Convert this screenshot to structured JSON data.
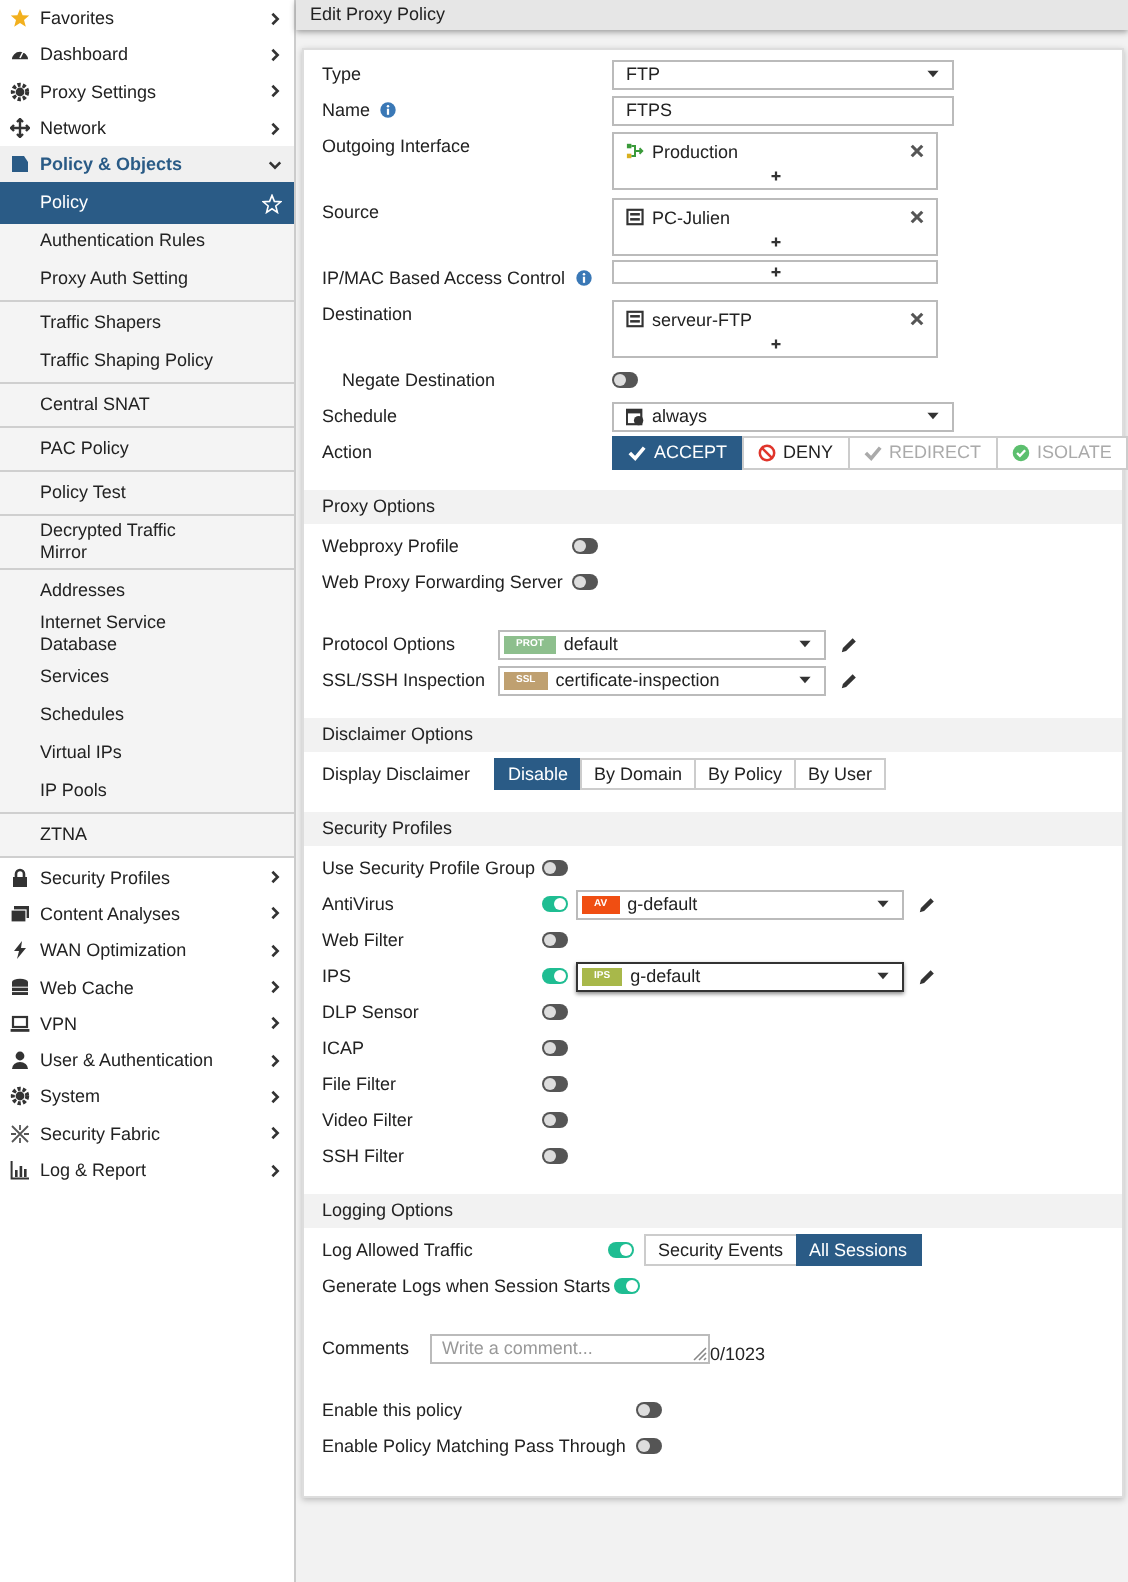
{
  "sidebar": {
    "items": [
      {
        "label": "Favorites",
        "expanded": false
      },
      {
        "label": "Dashboard",
        "expanded": false
      },
      {
        "label": "Proxy Settings",
        "expanded": false
      },
      {
        "label": "Network",
        "expanded": false
      },
      {
        "label": "Policy & Objects",
        "expanded": true,
        "child_groups": [
          {
            "items": [
              {
                "label": "Policy",
                "selected": true
              },
              {
                "label": "Authentication Rules",
                "selected": false
              },
              {
                "label": "Proxy Auth Setting",
                "selected": false
              }
            ]
          },
          {
            "items": [
              {
                "label": "Traffic Shapers",
                "selected": false
              },
              {
                "label": "Traffic Shaping Policy",
                "selected": false
              }
            ]
          },
          {
            "items": [
              {
                "label": "Central SNAT",
                "selected": false
              }
            ]
          },
          {
            "items": [
              {
                "label": "PAC Policy",
                "selected": false
              }
            ]
          },
          {
            "items": [
              {
                "label": "Policy Test",
                "selected": false
              }
            ]
          },
          {
            "items": [
              {
                "label": "Decrypted Traffic Mirror",
                "selected": false
              }
            ]
          },
          {
            "items": [
              {
                "label": "Addresses",
                "selected": false
              },
              {
                "label": "Internet Service Database",
                "selected": false
              },
              {
                "label": "Services",
                "selected": false
              },
              {
                "label": "Schedules",
                "selected": false
              },
              {
                "label": "Virtual IPs",
                "selected": false
              },
              {
                "label": "IP Pools",
                "selected": false
              }
            ]
          },
          {
            "items": [
              {
                "label": "ZTNA",
                "selected": false
              }
            ]
          }
        ]
      },
      {
        "label": "Security Profiles",
        "expanded": false
      },
      {
        "label": "Content Analyses",
        "expanded": false
      },
      {
        "label": "WAN Optimization",
        "expanded": false
      },
      {
        "label": "Web Cache",
        "expanded": false
      },
      {
        "label": "VPN",
        "expanded": false
      },
      {
        "label": "User & Authentication",
        "expanded": false
      },
      {
        "label": "System",
        "expanded": false
      },
      {
        "label": "Security Fabric",
        "expanded": false
      },
      {
        "label": "Log & Report",
        "expanded": false
      }
    ]
  },
  "page_title": "Edit Proxy Policy",
  "sections": [
    {
      "groups": [
        {
          "rows": [
            {
              "kind": "select",
              "label": "Type",
              "value": "FTP"
            },
            {
              "kind": "text",
              "label": "Name",
              "info": true,
              "value": "FTPS"
            },
            {
              "kind": "multi",
              "label": "Outgoing Interface",
              "entries": [
                {
                  "kind": "interface",
                  "label": "Production"
                }
              ]
            },
            {
              "kind": "multi",
              "label": "Source",
              "entries": [
                {
                  "kind": "address",
                  "label": "PC-Julien"
                }
              ]
            },
            {
              "kind": "multi",
              "label": "IP/MAC Based Access Control",
              "info": true
            },
            {
              "kind": "multi",
              "label": "Destination",
              "entries": [
                {
                  "kind": "address",
                  "label": "serveur-FTP"
                }
              ]
            },
            {
              "kind": "toggle",
              "label": "Negate Destination",
              "nested": true,
              "on": false
            },
            {
              "kind": "select",
              "label": "Schedule",
              "icon": true,
              "value": "always"
            },
            {
              "kind": "segmented",
              "label": "Action",
              "options": [
                {
                  "kind": "check",
                  "label": "ACCEPT",
                  "selected": true,
                  "disabled": false
                },
                {
                  "kind": "deny",
                  "label": "DENY",
                  "selected": false,
                  "disabled": false
                },
                {
                  "kind": "check",
                  "label": "REDIRECT",
                  "selected": false,
                  "disabled": true
                },
                {
                  "kind": "isolate",
                  "label": "ISOLATE",
                  "selected": false,
                  "disabled": true
                }
              ]
            }
          ]
        }
      ]
    },
    {
      "title": "Proxy Options",
      "groups": [
        {
          "rows": [
            {
              "kind": "toggle",
              "label": "Webproxy Profile",
              "on": false
            },
            {
              "kind": "toggle",
              "label": "Web Proxy Forwarding Server",
              "on": false
            }
          ]
        },
        {
          "rows": [
            {
              "kind": "profile",
              "label": "Protocol Options",
              "profile": {
                "badge": "PROT",
                "color": "#8dbf8d",
                "value": "default"
              }
            },
            {
              "kind": "profile",
              "label": "SSL/SSH Inspection",
              "profile": {
                "badge": "SSL",
                "color": "#bfa070",
                "value": "certificate-inspection"
              }
            }
          ]
        }
      ]
    },
    {
      "title": "Disclaimer Options",
      "groups": [
        {
          "rows": [
            {
              "kind": "segmented",
              "label": "Display Disclaimer",
              "options": [
                {
                  "label": "Disable",
                  "selected": true
                },
                {
                  "label": "By Domain",
                  "selected": false
                },
                {
                  "label": "By Policy",
                  "selected": false
                },
                {
                  "label": "By User",
                  "selected": false
                }
              ]
            }
          ]
        }
      ]
    },
    {
      "title": "Security Profiles",
      "groups": [
        {
          "rows": [
            {
              "kind": "toggle",
              "label": "Use Security Profile Group",
              "on": false
            },
            {
              "kind": "toggle",
              "label": "AntiVirus",
              "on": true,
              "profile": {
                "badge": "AV",
                "color": "#f04e12",
                "value": "g-default",
                "focused": false
              }
            },
            {
              "kind": "toggle",
              "label": "Web Filter",
              "on": false
            },
            {
              "kind": "toggle",
              "label": "IPS",
              "on": true,
              "profile": {
                "badge": "IPS",
                "color": "#a8b84a",
                "value": "g-default",
                "focused": true
              }
            },
            {
              "kind": "toggle",
              "label": "DLP Sensor",
              "on": false
            },
            {
              "kind": "toggle",
              "label": "ICAP",
              "on": false
            },
            {
              "kind": "toggle",
              "label": "File Filter",
              "on": false
            },
            {
              "kind": "toggle",
              "label": "Video Filter",
              "on": false
            },
            {
              "kind": "toggle",
              "label": "SSH Filter",
              "on": false
            }
          ]
        }
      ]
    },
    {
      "title": "Logging Options",
      "groups": [
        {
          "rows": [
            {
              "kind": "toggle",
              "label": "Log Allowed Traffic",
              "on": true,
              "options": [
                {
                  "label": "Security Events",
                  "selected": false
                },
                {
                  "label": "All Sessions",
                  "selected": true
                }
              ]
            },
            {
              "kind": "toggle",
              "label": "Generate Logs when Session Starts",
              "on": true
            }
          ]
        },
        {
          "rows": [
            {
              "kind": "comment",
              "label": "Comments",
              "placeholder": "Write a comment...",
              "counter": "0/1023"
            }
          ]
        },
        {
          "rows": [
            {
              "kind": "toggle",
              "label": "Enable this policy",
              "on": false
            },
            {
              "kind": "toggle",
              "label": "Enable Policy Matching Pass Through",
              "on": false
            }
          ]
        }
      ]
    }
  ]
}
